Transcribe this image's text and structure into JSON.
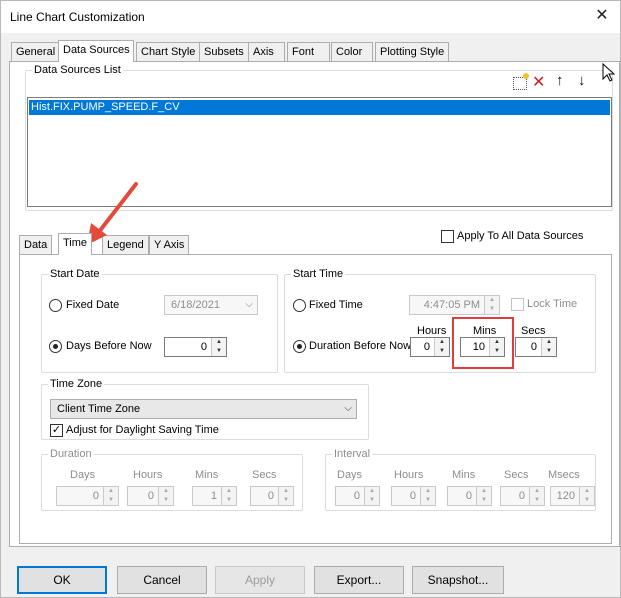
{
  "window": {
    "title": "Line Chart Customization",
    "close_glyph": "✕"
  },
  "top_tabs": [
    "General",
    "Data Sources",
    "Chart Style",
    "Subsets",
    "Axis",
    "Font",
    "Color",
    "Plotting Style"
  ],
  "data_sources": {
    "group_label": "Data Sources List",
    "items": [
      "Hist.FIX.PUMP_SPEED.F_CV"
    ],
    "toolbar_icons": [
      "new-icon",
      "delete-icon",
      "move-up-icon",
      "move-down-icon"
    ]
  },
  "sub_tabs": [
    "Data",
    "Time",
    "Legend",
    "Y Axis"
  ],
  "apply_all": {
    "label": "Apply To All Data Sources",
    "checked": false
  },
  "start_date": {
    "group_label": "Start Date",
    "fixed_label": "Fixed Date",
    "fixed_value": "6/18/2021",
    "days_label": "Days Before Now",
    "days_value": "0"
  },
  "start_time": {
    "group_label": "Start Time",
    "fixed_label": "Fixed Time",
    "fixed_value": "4:47:05 PM",
    "lock_label": "Lock Time",
    "duration_label": "Duration Before Now",
    "hours_label": "Hours",
    "mins_label": "Mins",
    "secs_label": "Secs",
    "hours_value": "0",
    "mins_value": "10",
    "secs_value": "0"
  },
  "time_zone": {
    "group_label": "Time Zone",
    "selected": "Client Time Zone",
    "dst_label": "Adjust for Daylight Saving Time",
    "dst_checked": true
  },
  "duration": {
    "group_label": "Duration",
    "days_label": "Days",
    "hours_label": "Hours",
    "mins_label": "Mins",
    "secs_label": "Secs",
    "days_value": "0",
    "hours_value": "0",
    "mins_value": "1",
    "secs_value": "0"
  },
  "interval": {
    "group_label": "Interval",
    "days_label": "Days",
    "hours_label": "Hours",
    "mins_label": "Mins",
    "secs_label": "Secs",
    "msecs_label": "Msecs",
    "days_value": "0",
    "hours_value": "0",
    "mins_value": "0",
    "secs_value": "0",
    "msecs_value": "120"
  },
  "buttons": {
    "ok": "OK",
    "cancel": "Cancel",
    "apply": "Apply",
    "export": "Export...",
    "snapshot": "Snapshot..."
  },
  "colors": {
    "selection": "#0078d7",
    "highlight": "#e03c3c",
    "arrow": "#e24b3b"
  }
}
